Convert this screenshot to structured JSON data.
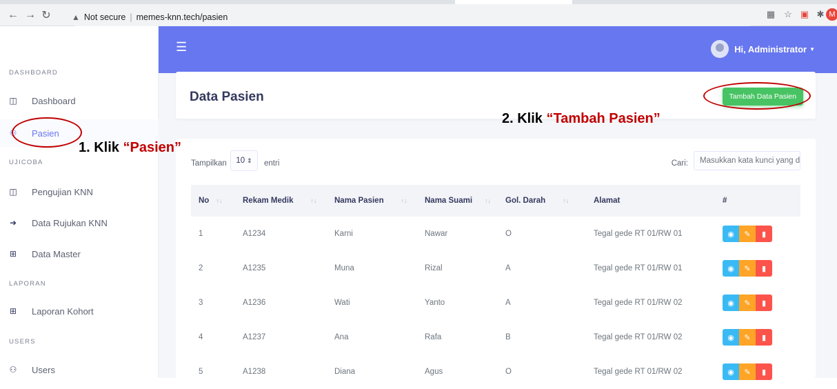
{
  "browser": {
    "address_warning": "Not secure",
    "url": "memes-knn.tech/pasien",
    "profile_initial": "M"
  },
  "topbar": {
    "user_label": "Hi, Administrator"
  },
  "sidebar": {
    "sections": [
      {
        "label": "DASHBOARD"
      },
      {
        "label": "UJICOBA"
      },
      {
        "label": "LAPORAN"
      },
      {
        "label": "USERS"
      }
    ],
    "items": [
      {
        "label": "Dashboard",
        "icon": "columns-icon"
      },
      {
        "label": "Pasien",
        "icon": "users-icon",
        "active": true
      },
      {
        "label": "Pengujian KNN",
        "icon": "columns-icon"
      },
      {
        "label": "Data Rujukan KNN",
        "icon": "sign-in-icon"
      },
      {
        "label": "Data Master",
        "icon": "table-icon"
      },
      {
        "label": "Laporan Kohort",
        "icon": "table-icon"
      },
      {
        "label": "Users",
        "icon": "users-icon"
      }
    ]
  },
  "header": {
    "title": "Data Pasien",
    "add_button": "Tambah Data Pasien"
  },
  "table_controls": {
    "show_label": "Tampilkan",
    "page_length": "10",
    "entries_label": "entri",
    "search_label": "Cari:",
    "search_placeholder": "Masukkan kata kunci yang dicari"
  },
  "table": {
    "columns": [
      "No",
      "Rekam Medik",
      "Nama Pasien",
      "Nama Suami",
      "Gol. Darah",
      "Alamat",
      "#"
    ],
    "rows": [
      [
        "1",
        "A1234",
        "Karni",
        "Nawar",
        "O",
        "Tegal gede RT 01/RW 01"
      ],
      [
        "2",
        "A1235",
        "Muna",
        "Rizal",
        "A",
        "Tegal gede RT 01/RW 01"
      ],
      [
        "3",
        "A1236",
        "Wati",
        "Yanto",
        "A",
        "Tegal gede RT 01/RW 02"
      ],
      [
        "4",
        "A1237",
        "Ana",
        "Rafa",
        "B",
        "Tegal gede RT 01/RW 02"
      ],
      [
        "5",
        "A1238",
        "Diana",
        "Agus",
        "O",
        "Tegal gede RT 01/RW 02"
      ]
    ]
  },
  "annotations": {
    "step1_prefix": "1.  Klik ",
    "step1_target": "“Pasien”",
    "step2_prefix": "2.  Klik ",
    "step2_target": "“Tambah Pasien”"
  },
  "colors": {
    "primary": "#6777ef",
    "success": "#47c363",
    "info": "#3abaf4",
    "warning": "#ffa426",
    "danger": "#fc544b",
    "annotation": "#c00000"
  }
}
